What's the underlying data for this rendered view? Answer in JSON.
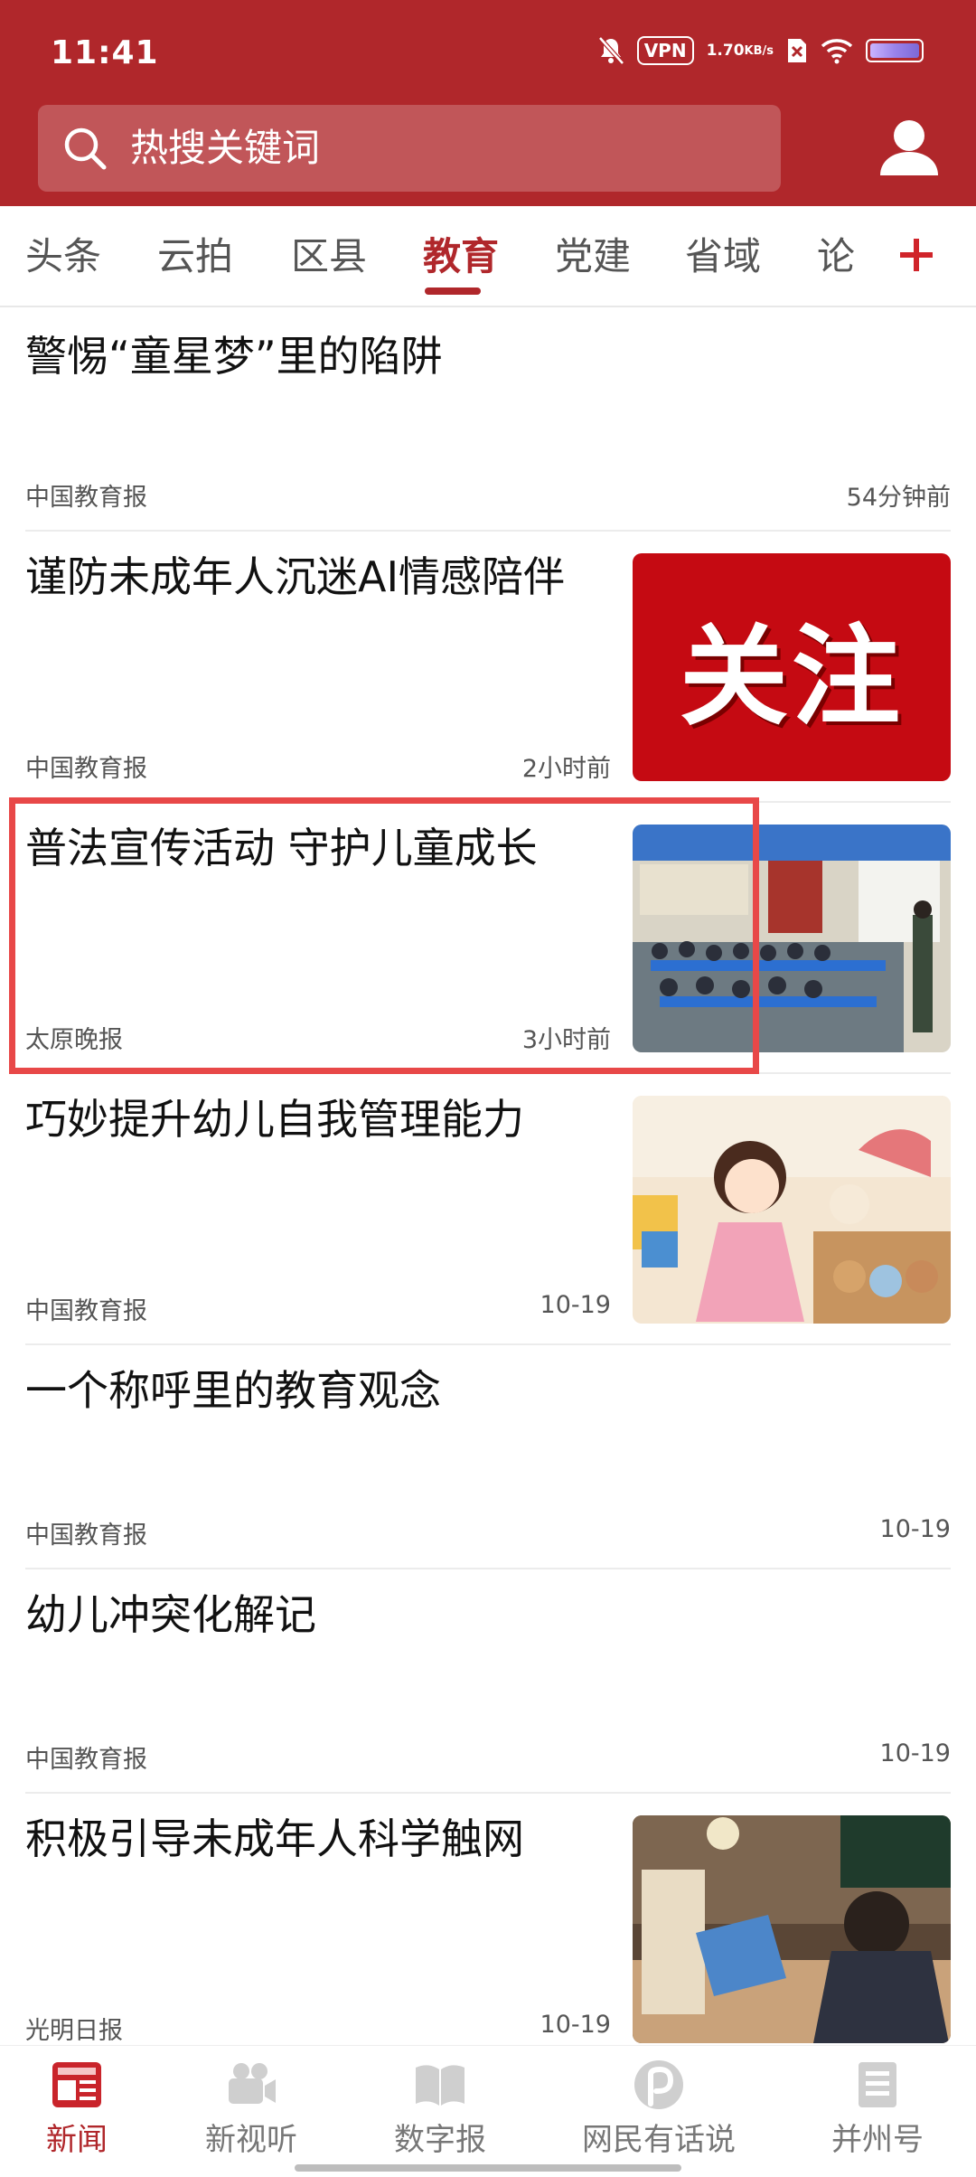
{
  "status_bar": {
    "time": "11:41",
    "vpn": "VPN",
    "speed_value": "1.70",
    "speed_unit": "KB/s"
  },
  "search": {
    "placeholder": "热搜关键词"
  },
  "colors": {
    "brand_red": "#b0272b",
    "highlight": "#e84848"
  },
  "tabs": [
    {
      "label": "头条"
    },
    {
      "label": "云拍"
    },
    {
      "label": "区县"
    },
    {
      "label": "教育",
      "active": true
    },
    {
      "label": "党建"
    },
    {
      "label": "省域"
    },
    {
      "label": "论"
    }
  ],
  "articles": [
    {
      "title": "警惕“童星梦”里的陷阱",
      "source": "中国教育报",
      "time": "54分钟前",
      "thumbnail": null
    },
    {
      "title": "谨防未成年人沉迷AI情感陪伴",
      "source": "中国教育报",
      "time": "2小时前",
      "thumbnail": "关注"
    },
    {
      "title": "普法宣传活动 守护儿童成长",
      "source": "太原晚报",
      "time": "3小时前",
      "thumbnail": "classroom-photo"
    },
    {
      "title": "巧妙提升幼儿自我管理能力",
      "source": "中国教育报",
      "time": "10-19",
      "thumbnail": "cartoon-girl-toys"
    },
    {
      "title": "一个称呼里的教育观念",
      "source": "中国教育报",
      "time": "10-19",
      "thumbnail": null
    },
    {
      "title": "幼儿冲突化解记",
      "source": "中国教育报",
      "time": "10-19",
      "thumbnail": null
    },
    {
      "title": "积极引导未成年人科学触网",
      "source": "光明日报",
      "time": "10-19",
      "thumbnail": "boy-laptop-photo"
    }
  ],
  "bottom_nav": [
    {
      "label": "新闻",
      "icon": "newspaper-icon",
      "active": true
    },
    {
      "label": "新视听",
      "icon": "video-camera-icon"
    },
    {
      "label": "数字报",
      "icon": "open-book-icon"
    },
    {
      "label": "网民有话说",
      "icon": "speech-p-icon"
    },
    {
      "label": "并州号",
      "icon": "document-icon"
    }
  ]
}
